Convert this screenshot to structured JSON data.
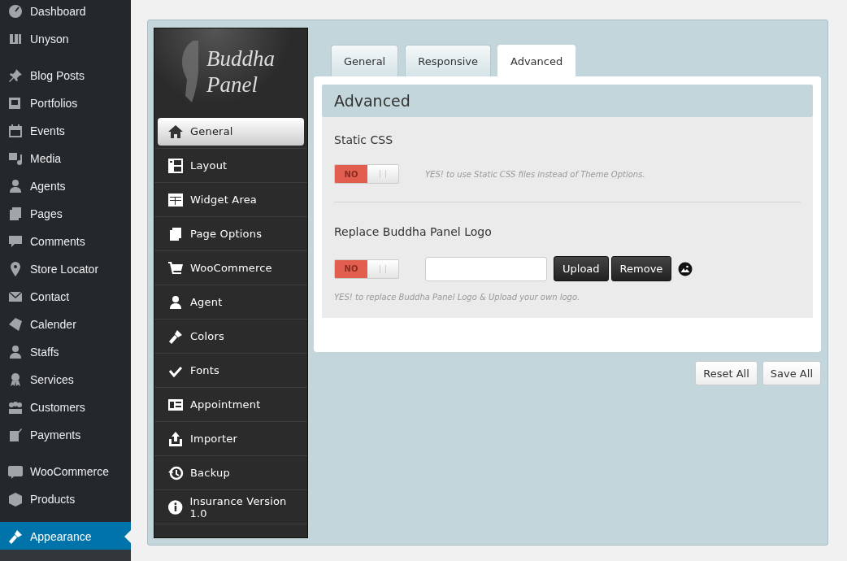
{
  "wp_sidebar": {
    "groups": [
      [
        {
          "label": "Dashboard",
          "selected": false
        },
        {
          "label": "Unyson",
          "selected": false
        }
      ],
      [
        {
          "label": "Blog Posts",
          "selected": false
        },
        {
          "label": "Portfolios",
          "selected": false
        },
        {
          "label": "Events",
          "selected": false
        },
        {
          "label": "Media",
          "selected": false
        },
        {
          "label": "Agents",
          "selected": false
        },
        {
          "label": "Pages",
          "selected": false
        },
        {
          "label": "Comments",
          "selected": false
        },
        {
          "label": "Store Locator",
          "selected": false
        },
        {
          "label": "Contact",
          "selected": false
        },
        {
          "label": "Calender",
          "selected": false
        },
        {
          "label": "Staffs",
          "selected": false
        },
        {
          "label": "Services",
          "selected": false
        },
        {
          "label": "Customers",
          "selected": false
        },
        {
          "label": "Payments",
          "selected": false
        }
      ],
      [
        {
          "label": "WooCommerce",
          "selected": false
        },
        {
          "label": "Products",
          "selected": false
        }
      ],
      [
        {
          "label": "Appearance",
          "selected": true
        }
      ]
    ]
  },
  "panel": {
    "logo": {
      "line1": "Buddha",
      "line2": "Panel"
    },
    "nav": [
      {
        "label": "General",
        "selected": true
      },
      {
        "label": "Layout",
        "selected": false
      },
      {
        "label": "Widget Area",
        "selected": false
      },
      {
        "label": "Page Options",
        "selected": false
      },
      {
        "label": "WooCommerce",
        "selected": false
      },
      {
        "label": "Agent",
        "selected": false
      },
      {
        "label": "Colors",
        "selected": false
      },
      {
        "label": "Fonts",
        "selected": false
      },
      {
        "label": "Appointment",
        "selected": false
      },
      {
        "label": "Importer",
        "selected": false
      },
      {
        "label": "Backup",
        "selected": false
      },
      {
        "label": "Insurance Version 1.0",
        "selected": false
      }
    ],
    "tabs": [
      {
        "label": "General",
        "selected": false
      },
      {
        "label": "Responsive",
        "selected": false
      },
      {
        "label": "Advanced",
        "selected": true
      }
    ],
    "section_title": "Advanced",
    "options": [
      {
        "title": "Static CSS",
        "toggle": {
          "on": false,
          "label": "NO"
        },
        "description": "YES! to use Static CSS files instead of Theme Options.",
        "kind": "toggle"
      },
      {
        "title": "Replace Buddha Panel Logo",
        "toggle": {
          "on": false,
          "label": "NO"
        },
        "description": "YES! to replace Buddha Panel Logo & Upload your own logo.",
        "kind": "upload",
        "buttons": [
          "Upload",
          "Remove"
        ]
      }
    ],
    "actions": [
      "Reset All",
      "Save All"
    ]
  }
}
